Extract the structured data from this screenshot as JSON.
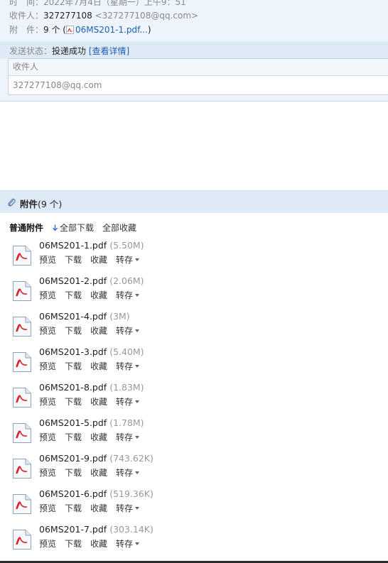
{
  "meta": {
    "time_label": "时　间：",
    "time_value": "2022年7月4日（星期一）上午9：51",
    "recipient_label": "收件人：",
    "recipient_name": "327277108",
    "recipient_email": "<327277108@qq.com>",
    "attach_label": "附　件：",
    "attach_count": "9 个 (",
    "attach_first": "06MS201-1.pdf...",
    "attach_close": ")"
  },
  "status": {
    "label": "发送状态：",
    "value": "投递成功",
    "details_link": "[查看详情]"
  },
  "recipient_table": {
    "header": "收件人",
    "rows": [
      "327277108@qq.com"
    ]
  },
  "attachments": {
    "title": "附件",
    "count": "(9 个)",
    "category": "普通附件",
    "download_all": "全部下载",
    "collect_all": "全部收藏",
    "op_preview": "预览",
    "op_download": "下载",
    "op_collect": "收藏",
    "op_forward": "转存",
    "files": [
      {
        "name": "06MS201-1.pdf",
        "size": "(5.50M)"
      },
      {
        "name": "06MS201-2.pdf",
        "size": "(2.06M)"
      },
      {
        "name": "06MS201-4.pdf",
        "size": "(3M)"
      },
      {
        "name": "06MS201-3.pdf",
        "size": "(5.40M)"
      },
      {
        "name": "06MS201-8.pdf",
        "size": "(1.83M)"
      },
      {
        "name": "06MS201-5.pdf",
        "size": "(1.78M)"
      },
      {
        "name": "06MS201-9.pdf",
        "size": "(743.62K)"
      },
      {
        "name": "06MS201-6.pdf",
        "size": "(519.36K)"
      },
      {
        "name": "06MS201-7.pdf",
        "size": "(303.14K)"
      }
    ]
  },
  "colors": {
    "link": "#1f5fb6",
    "header_bg": "#eef4fb",
    "bar_bg": "#dfeaf7",
    "pdf_red": "#d6202a"
  }
}
